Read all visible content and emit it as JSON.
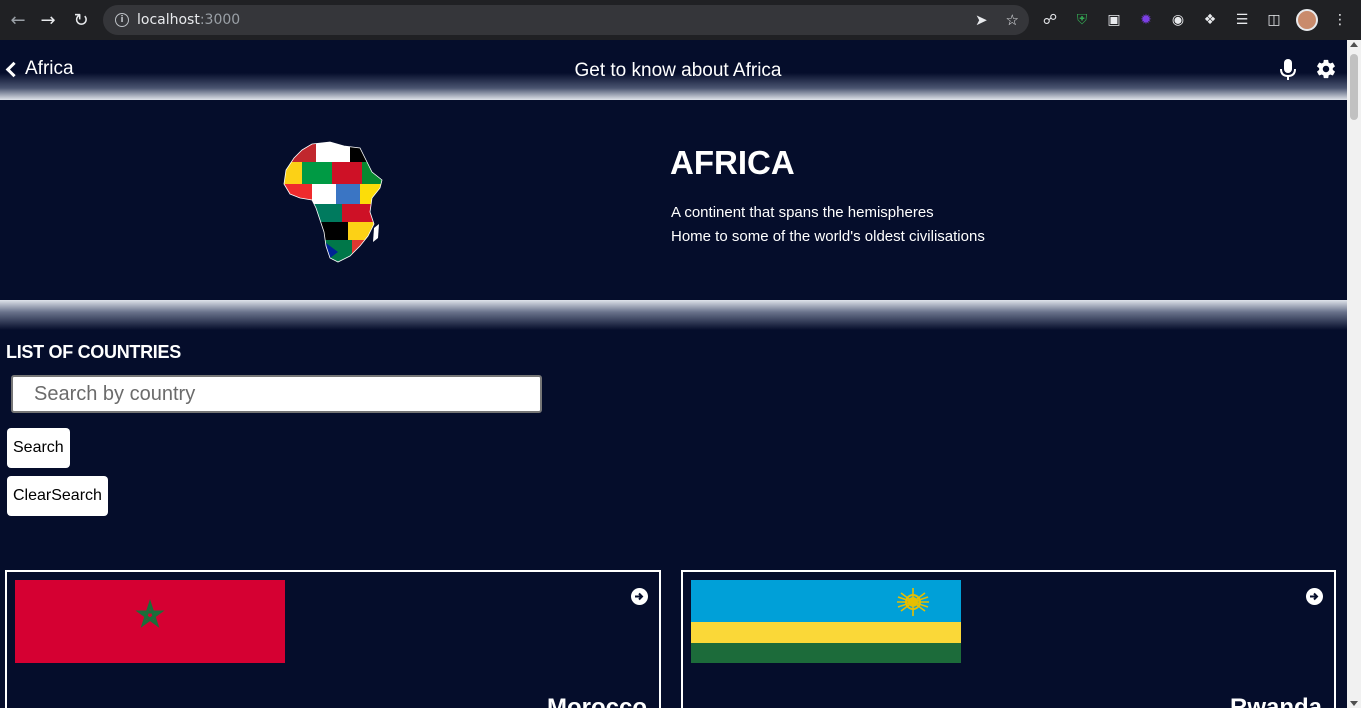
{
  "browser": {
    "url_host": "localhost",
    "url_port": ":3000"
  },
  "nav": {
    "back_label": "Africa",
    "title": "Get to know about Africa"
  },
  "hero": {
    "title": "AFRICA",
    "line1": "A continent that spans the hemispheres",
    "line2": "Home to some of the world's oldest civilisations"
  },
  "list": {
    "heading": "LIST OF COUNTRIES",
    "search_placeholder": "Search by country",
    "search_button": "Search",
    "clear_button": "ClearSearch"
  },
  "countries": [
    {
      "name": "Morocco",
      "flag": "morocco-flag"
    },
    {
      "name": "Rwanda",
      "flag": "rwanda-flag"
    }
  ],
  "colors": {
    "page_bg": "#050d2b",
    "morocco_red": "#d50032",
    "morocco_green": "#1b6e3a",
    "rwanda_blue": "#00a0d8",
    "rwanda_yellow": "#fad838",
    "rwanda_green": "#1c6b3a"
  }
}
